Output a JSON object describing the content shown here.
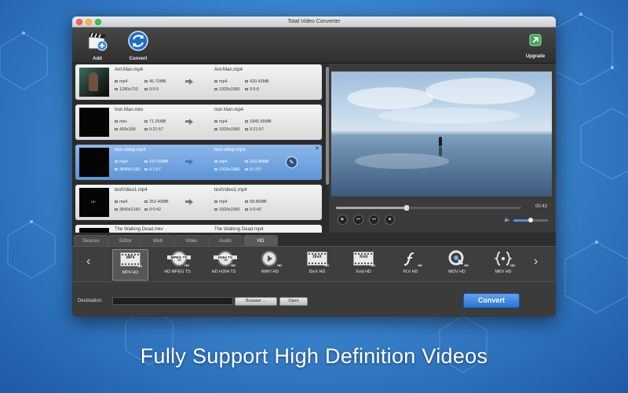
{
  "window": {
    "title": "Total Video Converter"
  },
  "toolbar": {
    "add_label": "Add",
    "convert_label": "Convert",
    "upgrade_label": "Upgrade"
  },
  "files": [
    {
      "src_name": "Ant-Man.mp4",
      "src_format": "mp4",
      "src_size": "45.70MB",
      "src_res": "1280x720",
      "src_duration": "0:5:0",
      "dst_name": "Ant-Man.mp4",
      "dst_format": "mp4",
      "dst_size": "420.42MB",
      "dst_res": "1920x1080",
      "dst_duration": "0:5:0",
      "selected": false
    },
    {
      "src_name": "Iron Man.mkv",
      "src_format": "mkv",
      "src_size": "71.25MB",
      "src_res": "400x268",
      "src_duration": "0:21:57",
      "dst_name": "Iron Man.mp4",
      "dst_format": "mp4",
      "dst_size": "1845.65MB",
      "dst_res": "1920x1080",
      "dst_duration": "0:21:57",
      "selected": false
    },
    {
      "src_name": "test-videp.mp4",
      "src_format": "mp4",
      "src_size": "157.03MB",
      "src_res": "3840x2160",
      "src_duration": "0:1:57",
      "dst_name": "test-videp.mp4",
      "dst_format": "mp4",
      "dst_size": "163.96MB",
      "dst_res": "1920x1080",
      "dst_duration": "0:1:57",
      "selected": true
    },
    {
      "src_name": "testVdieo1.mp4",
      "src_format": "mp4",
      "src_size": "252.40MB",
      "src_res": "3840x2160",
      "src_duration": "0:0:42",
      "dst_name": "testVdieo1.mp4",
      "dst_format": "mp4",
      "dst_size": "58.86MB",
      "dst_res": "1920x1080",
      "dst_duration": "0:0:42",
      "selected": false
    },
    {
      "src_name": "The Walking Dead.mkv",
      "dst_name": "The Walking Dead.mp4"
    }
  ],
  "player": {
    "time": "00:43",
    "seek_fraction": 0.38,
    "volume_fraction": 0.5
  },
  "tabs": [
    "Devices",
    "Editor",
    "Web",
    "Video",
    "Audio",
    "HD"
  ],
  "active_tab": "HD",
  "formats": [
    {
      "label": "MP4 HD",
      "icon": "MP4"
    },
    {
      "label": "HD MPEG TS",
      "icon": "MPEG TS"
    },
    {
      "label": "HD H264 TS",
      "icon": "H264 TS"
    },
    {
      "label": "WMV HD",
      "icon": "wmv"
    },
    {
      "label": "DivX HD",
      "icon": "DivX"
    },
    {
      "label": "Xvid HD",
      "icon": "Xvid"
    },
    {
      "label": "FLV HD",
      "icon": "flash"
    },
    {
      "label": "MOV HD",
      "icon": "quicktime"
    },
    {
      "label": "MKV HD",
      "icon": "mkv"
    }
  ],
  "selected_format": "MP4 HD",
  "destination": {
    "label": "Destination:",
    "value": "",
    "browse_label": "Browser ...",
    "open_label": "Open"
  },
  "convert_button": "Convert",
  "caption": "Fully Support High Definition Videos",
  "colors": {
    "accent": "#3a7fd8",
    "selected_row": "#6a9fdc",
    "window_bg": "#3b3b3b"
  }
}
